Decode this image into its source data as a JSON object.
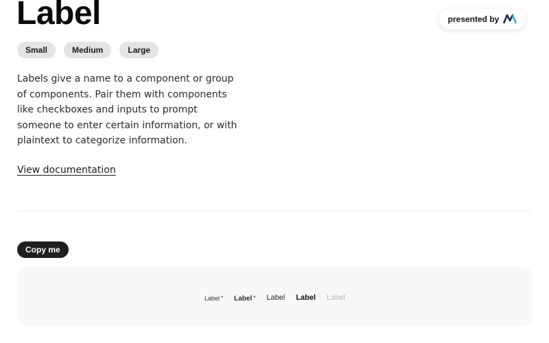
{
  "header": {
    "title": "Label"
  },
  "sizes": [
    "Small",
    "Medium",
    "Large"
  ],
  "presented": {
    "text": "presented by",
    "logo_icon": "brand-logo-icon"
  },
  "description": "Labels give a name to a component or group of components. Pair them with components like checkboxes and inputs to prompt someone to enter certain information, or with plaintext to categorize information.",
  "doc_link": "View documentation",
  "copy_button": "Copy me",
  "preview": {
    "labels": [
      {
        "text": "Label",
        "required_mark": "*"
      },
      {
        "text": "Label",
        "required_mark": "*"
      },
      {
        "text": "Label"
      },
      {
        "text": "Label"
      },
      {
        "text": "Label"
      }
    ]
  },
  "colors": {
    "pill_bg": "#e4e4e4",
    "button_dark": "#1f1f1f",
    "preview_bg": "#f8f8f8",
    "disabled_text": "#b5b5b5"
  }
}
